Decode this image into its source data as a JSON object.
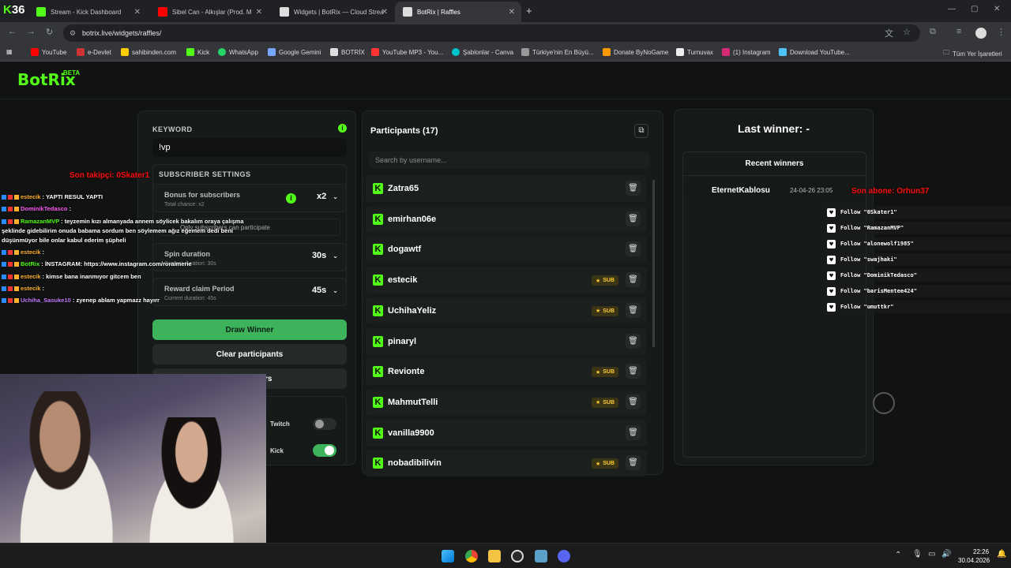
{
  "tabs": [
    {
      "title": "Stream - Kick Dashboard",
      "color": "#53fc18",
      "active": false
    },
    {
      "title": "Sibel Can - Alkışlar (Prod. M",
      "color": "#ff0000",
      "active": false
    },
    {
      "title": "Widgets | BotRix — Cloud Strea",
      "color": "#ffffff",
      "active": false
    },
    {
      "title": "BotRix | Raffles",
      "color": "#ffffff",
      "active": true
    }
  ],
  "address": {
    "url": "botrix.live/widgets/raffles/"
  },
  "bookmarks": [
    "YouTube",
    "e-Devlet",
    "sahibinden.com",
    "Kick",
    "WhatsApp",
    "Google Gemini",
    "BOTRİX",
    "YouTube MP3 - You...",
    "Şablonlar - Canva",
    "Türkiye'nin En Büyü...",
    "Donate ByNoGame",
    "Turnuvax",
    "(1) Instagram",
    "Download YouTube...",
    "Tüm Yer İşaretleri"
  ],
  "app": {
    "logo": "BotRix",
    "badge": "BETA"
  },
  "settings": {
    "keyword_label": "KEYWORD",
    "keyword_value": "!vp",
    "subscriber_header": "SUBSCRIBER SETTINGS",
    "bonus_title": "Bonus for subscribers",
    "bonus_sub": "Total chance: x2",
    "bonus_value": "x2",
    "only_subs_text": "Only subscribers can participate",
    "spin_title": "Spin duration",
    "spin_sub": "Current duration: 30s",
    "spin_value": "30s",
    "reward_title": "Reward claim Period",
    "reward_sub": "Current duration: 45s",
    "reward_value": "45s",
    "draw_button": "Draw Winner",
    "clear_button": "Clear participants",
    "third_button": "rs",
    "twitch_label": "Twitch",
    "kick_label": "Kick"
  },
  "participants": {
    "title": "Participants (17)",
    "search_placeholder": "Search by username...",
    "sub_label": "SUB",
    "list": [
      {
        "name": "Zatra65",
        "sub": false
      },
      {
        "name": "emirhan06e",
        "sub": false
      },
      {
        "name": "dogawtf",
        "sub": false
      },
      {
        "name": "estecik",
        "sub": true
      },
      {
        "name": "UchihaYeliz",
        "sub": true
      },
      {
        "name": "pinaryl",
        "sub": false
      },
      {
        "name": "Revionte",
        "sub": true
      },
      {
        "name": "MahmutTelli",
        "sub": true
      },
      {
        "name": "vanilla9900",
        "sub": false
      },
      {
        "name": "nobadibilivin",
        "sub": true
      }
    ]
  },
  "winner": {
    "title": "Last winner: -",
    "recent_header": "Recent winners",
    "recent": [
      {
        "name": "EternetKablosu",
        "date": "24-04-26 23:05"
      }
    ]
  },
  "overlay": {
    "last_follower": "Son takipçi: 0Skater1",
    "last_sub": "Son abone: Orhun37",
    "chat": [
      {
        "user": "estecik",
        "color": "#ffb02e",
        "msg": " : YAPTI RESUL YAPTI"
      },
      {
        "user": "DominikTedasco",
        "color": "#ff5cf4",
        "msg": " : "
      },
      {
        "user": "RamazanMVP",
        "color": "#53fc18",
        "msg": " : teyzemin kızı almanyada annem söylicek bakalım oraya çalışma"
      },
      {
        "user": "",
        "color": "#ffffff",
        "msg": "şeklinde gidebilirim onuda babama sordum ben söylemem ağız eğemem dedi beni"
      },
      {
        "user": "",
        "color": "#ffffff",
        "msg": "düşünmüyor bile onlar kabul ederim şüpheli"
      },
      {
        "user": "estecik",
        "color": "#ffb02e",
        "msg": " : "
      },
      {
        "user": "BotRix",
        "color": "#53fc18",
        "msg": " : İNSTAGRAM: https://www.instagram.com/roraimerie"
      },
      {
        "user": "estecik",
        "color": "#ffb02e",
        "msg": " : kimse bana inanmıyor gitcem ben"
      },
      {
        "user": "estecik",
        "color": "#ffb02e",
        "msg": " : "
      },
      {
        "user": "Uchiha_Sasuke10",
        "color": "#c77dff",
        "msg": " : zyenep ablam yapmazz hayırr"
      }
    ],
    "follows": [
      "Follow \"0Skater1\"",
      "Follow \"RamazanMVP\"",
      "Follow \"alonewolf1985\"",
      "Follow \"swajhaki\"",
      "Follow \"DominikTedasco\"",
      "Follow \"barisMentee424\"",
      "Follow \"umuttkr\""
    ]
  },
  "taskbar": {
    "time": "22:26",
    "date": "30.04.2026"
  }
}
